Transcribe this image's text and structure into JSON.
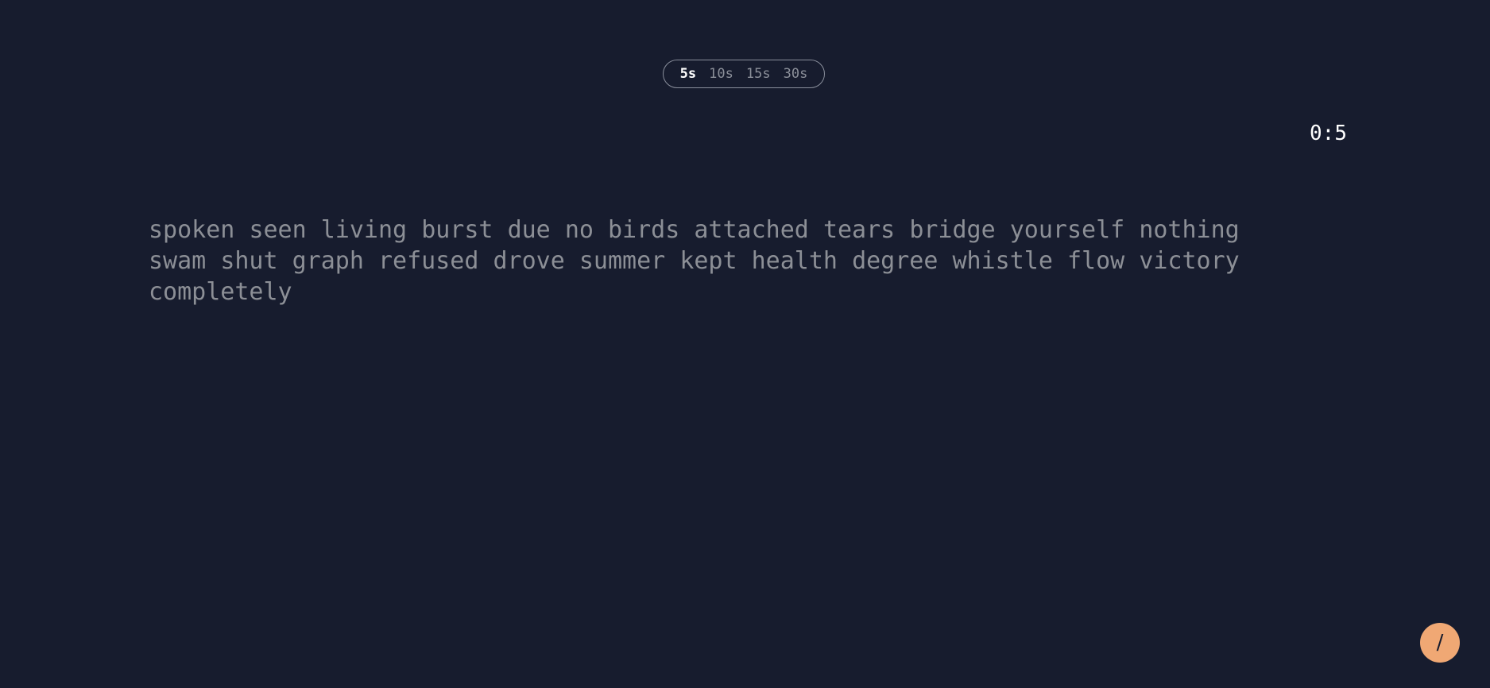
{
  "duration_selector": {
    "options": [
      {
        "label": "5s",
        "active": true
      },
      {
        "label": "10s",
        "active": false
      },
      {
        "label": "15s",
        "active": false
      },
      {
        "label": "30s",
        "active": false
      }
    ]
  },
  "timer": {
    "value": "0:5"
  },
  "words": [
    "spoken",
    "seen",
    "living",
    "burst",
    "due",
    "no",
    "birds",
    "attached",
    "tears",
    "bridge",
    "yourself",
    "nothing",
    "swam",
    "shut",
    "graph",
    "refused",
    "drove",
    "summer",
    "kept",
    "health",
    "degree",
    "whistle",
    "flow",
    "victory",
    "completely"
  ],
  "fab": {
    "icon": "slash-icon",
    "glyph": "/"
  },
  "colors": {
    "background": "#171c2e",
    "text_untyped": "#8c8f96",
    "text_active": "#ffffff",
    "accent": "#f0a874"
  }
}
